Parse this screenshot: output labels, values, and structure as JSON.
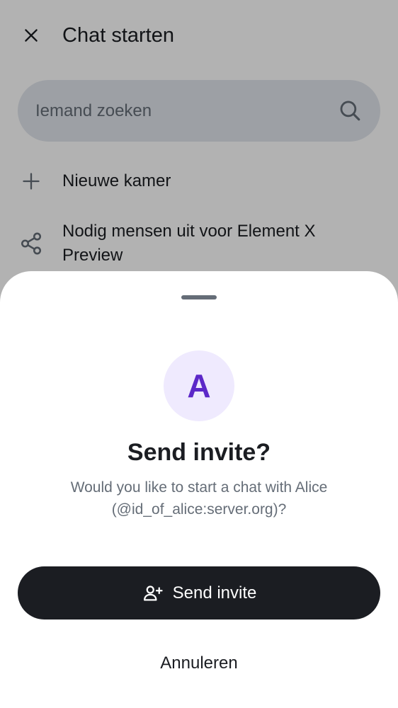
{
  "screen": {
    "title": "Chat starten",
    "search": {
      "placeholder": "Iemand zoeken",
      "value": ""
    },
    "items": [
      {
        "label": "Nieuwe kamer",
        "icon": "plus-icon"
      },
      {
        "label": "Nodig mensen uit voor Element X Preview",
        "icon": "share-icon"
      }
    ]
  },
  "dialog": {
    "avatar_initial": "A",
    "title": "Send invite?",
    "message": "Would you like to start a chat with Alice (@id_of_alice:server.org)?",
    "primary_button": {
      "label": "Send invite",
      "icon": "add-user-icon"
    },
    "secondary_button": {
      "label": "Annuleren"
    }
  },
  "colors": {
    "text_primary": "#1b1d22",
    "text_secondary": "#656d77",
    "avatar_bg": "#efeafe",
    "avatar_fg": "#5c28c8",
    "button_bg": "#1b1d22",
    "button_fg": "#ffffff",
    "search_bg": "#e1e6ec"
  }
}
